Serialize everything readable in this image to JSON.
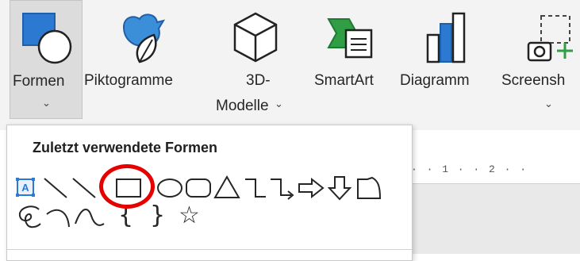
{
  "ribbon": {
    "buttons": [
      {
        "id": "formen",
        "label": "Formen",
        "has_dropdown": true,
        "icon": "shapes-icon",
        "selected": true
      },
      {
        "id": "piktogramme",
        "label": "Piktogramme",
        "has_dropdown": false,
        "icon": "pictograms-icon"
      },
      {
        "id": "3d-modelle",
        "label_line1": "3D-",
        "label_line2": "Modelle",
        "has_dropdown": true,
        "icon": "3d-models-icon"
      },
      {
        "id": "smartart",
        "label": "SmartArt",
        "has_dropdown": false,
        "icon": "smartart-icon"
      },
      {
        "id": "diagramm",
        "label": "Diagramm",
        "has_dropdown": false,
        "icon": "chart-icon"
      },
      {
        "id": "screenshot",
        "label": "Screensh",
        "has_dropdown": true,
        "icon": "screenshot-icon"
      }
    ],
    "caret_glyph": "⌄"
  },
  "shapes_dropdown": {
    "heading": "Zuletzt verwendete Formen",
    "row1": [
      "text-box-icon",
      "line-icon",
      "line-arrow-icon",
      "rectangle-icon",
      "oval-icon",
      "rounded-rectangle-icon",
      "triangle-icon",
      "elbow-connector-icon",
      "elbow-arrow-connector-icon",
      "right-arrow-icon",
      "down-arrow-icon",
      "snip-corner-rectangle-icon"
    ],
    "row2": [
      "freeform-scribble-icon",
      "arc-icon",
      "curve-icon",
      "left-brace-icon",
      "right-brace-icon",
      "star-icon"
    ],
    "textbox_letter": "A",
    "left_brace": "{",
    "right_brace": "}",
    "star": "☆",
    "highlighted_shape": "rectangle-icon",
    "highlight_color": "#e60000"
  },
  "ruler": {
    "text": "·  ·  1  ·  ·  2  ·  ·"
  },
  "colors": {
    "ribbon_bg": "#f3f3f3",
    "icon_blue": "#1f6fc5",
    "icon_green": "#2f9e44"
  }
}
